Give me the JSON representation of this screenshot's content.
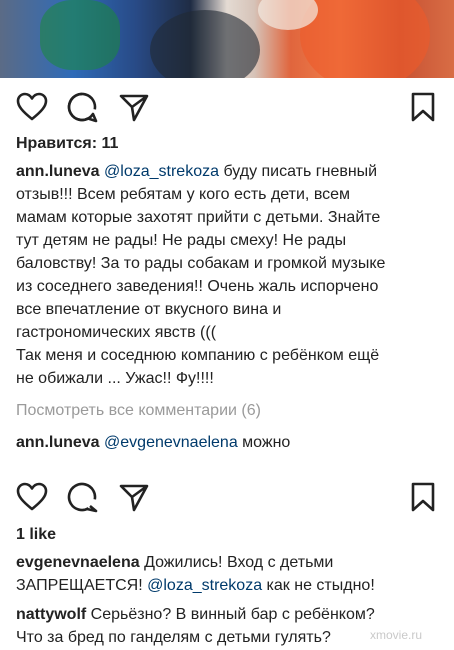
{
  "post1": {
    "likes": "Нравится: 11",
    "caption_user": "ann.luneva",
    "caption_mention": "@loza_strekoza",
    "caption_line1_rest": " буду писать гневный",
    "caption_lines": [
      "отзыв!!! Всем ребятам у кого есть дети, всем",
      "мамам которые захотят прийти с детьми. Знайте",
      "тут детям не рады! Не рады смеху! Не рады",
      "баловству! За то рады собакам и громкой музыке",
      "из соседнего заведения!! Очень жаль испорчено",
      "все впечатление от вкусного вина и",
      "гастрономических явств (((",
      "Так меня и соседнюю компанию с ребёнком ещё",
      "не обижали ... Ужас!! Фу!!!!"
    ],
    "view_all": "Посмотреть все комментарии (6)",
    "comment": {
      "user": "ann.luneva",
      "mention": "@evgenevnaelena",
      "text": " можно"
    }
  },
  "post2": {
    "likes": "1 like",
    "comments": [
      {
        "user": "evgenevnaelena",
        "text1": " Дожились! Вход с детьми",
        "line2_before": "ЗАПРЕЩАЕТСЯ! ",
        "mention": "@loza_strekoza",
        "line2_after": " как не стыдно!"
      },
      {
        "user": "nattywolf",
        "text1": " Серьёзно? В винный бар с ребёнком?",
        "line2": "Что за бред по ганделям с детьми гулять?"
      }
    ]
  },
  "icons": {
    "like": "heart-icon",
    "comment": "comment-icon",
    "share": "direct-share-icon",
    "save": "bookmark-icon"
  },
  "watermark": "xmovie.ru"
}
